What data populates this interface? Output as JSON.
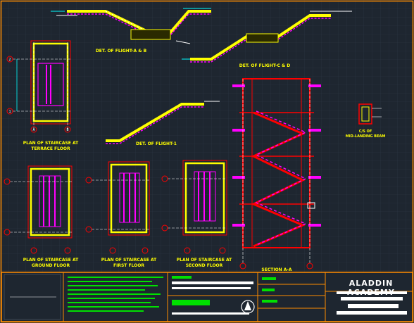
{
  "drawing": {
    "elevations": {
      "flight_a_b": "DET. OF FLIGHT-A & B",
      "flight_c_d": "DET. OF FLIGHT-C & D",
      "flight_1": "DET. OF FLIGHT-1"
    },
    "plans": [
      {
        "id": "terrace",
        "line1": "PLAN OF STAIRCASE AT",
        "line2": "TERRACE FLOOR"
      },
      {
        "id": "ground",
        "line1": "PLAN OF STAIRCASE AT",
        "line2": "GROUND FLOOR"
      },
      {
        "id": "first",
        "line1": "PLAN OF STAIRCASE AT",
        "line2": "FIRST FLOOR"
      },
      {
        "id": "second",
        "line1": "PLAN OF STAIRCASE AT",
        "line2": "SECOND FLOOR"
      }
    ],
    "section_label": "SECTION A-A",
    "beam_detail": {
      "line1": "C/S OF",
      "line2": "MID-LANDING BEAM"
    },
    "grid_markers": {
      "one": "1",
      "two": "2",
      "three": "3",
      "a": "A",
      "b": "B"
    }
  },
  "title_block": {
    "company": "ALADDIN ACADEMY",
    "notes": [
      "1. ALL DIMENSIONS ARE IN MM"
    ]
  },
  "colors": {
    "background": "#1e2630",
    "grid": "#2c3744",
    "frame": "#ff8c00",
    "wall": "#ffff00",
    "stair": "#ff00ff",
    "section": "#ff0000",
    "dimension": "#00ffff",
    "note": "#00e000"
  },
  "icons": {
    "north_symbol": "north-arrow-icon"
  }
}
